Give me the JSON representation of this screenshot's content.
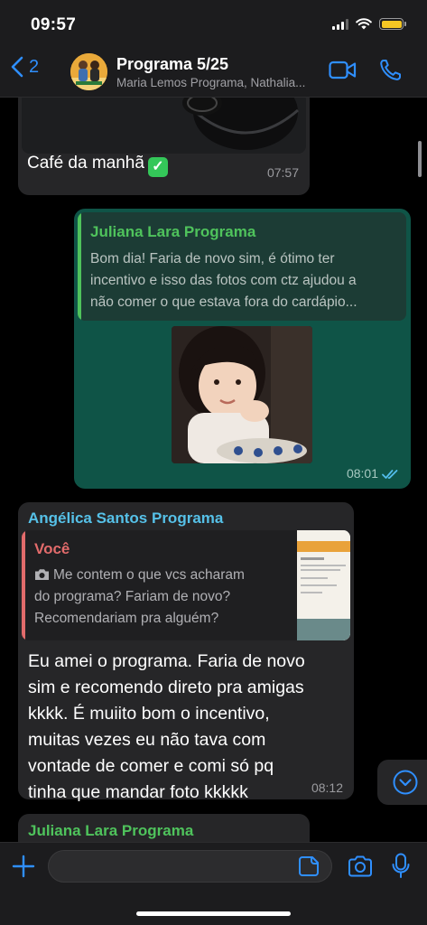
{
  "status_bar": {
    "time": "09:57"
  },
  "header": {
    "back_count": "2",
    "title": "Programa 5/25",
    "subtitle": "Maria Lemos Programa, Nathalia..."
  },
  "messages": [
    {
      "caption": "Café da manhã",
      "time": "07:57"
    },
    {
      "reply_name": "Juliana Lara Programa",
      "reply_text": "Bom dia! Faria de novo sim, é ótimo ter\nincentivo e isso das fotos com ctz ajudou a\nnão comer o que estava fora do cardápio...",
      "time": "08:01"
    },
    {
      "sender": "Angélica Santos Programa",
      "reply_name": "Você",
      "reply_text_line1": "Me contem o que vcs acharam",
      "reply_text_rest": "do programa? Fariam de novo?\nRecomendariam pra alguém?",
      "body": "Eu amei o programa. Faria de novo\nsim e recomendo direto pra amigas\nkkkk. É muiito bom o incentivo,\nmuitas vezes eu não tava com\nvontade de comer e comi só pq\ntinha que mandar foto kkkkk",
      "time": "08:12"
    },
    {
      "sender": "Juliana Lara Programa"
    }
  ],
  "colors": {
    "accent": "#2f8fff",
    "outgoing_bubble": "#0f5447",
    "incoming_bubble": "#262628",
    "green_name": "#4fc35c",
    "blue_name": "#56c1e8",
    "red_name": "#e26b6b"
  },
  "icons": [
    "chevron-left-icon",
    "video-call-icon",
    "phone-icon",
    "double-check-icon",
    "camera-icon",
    "chevron-down-icon",
    "plus-icon",
    "sticker-icon",
    "microphone-icon"
  ]
}
